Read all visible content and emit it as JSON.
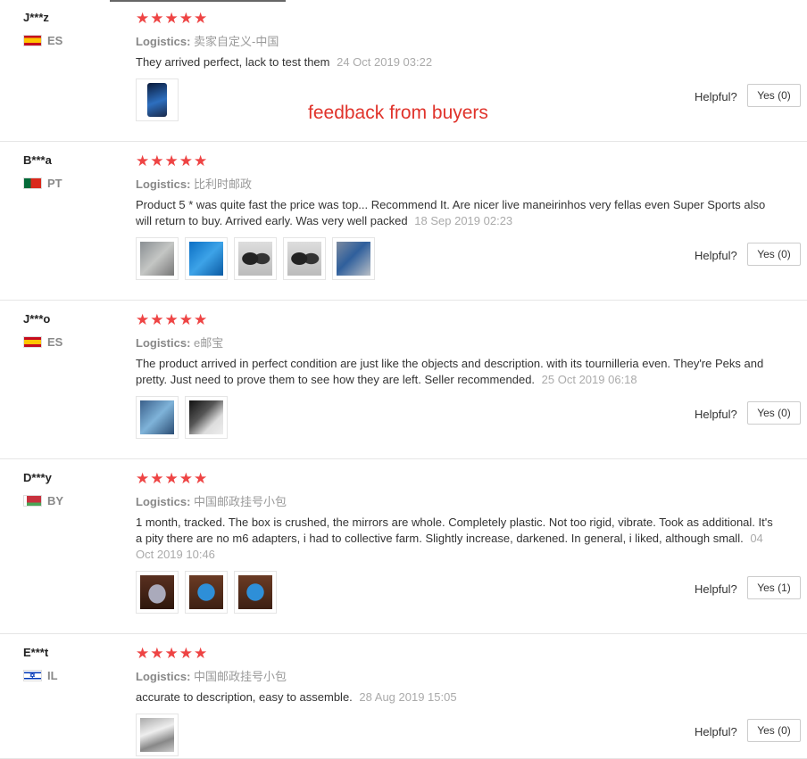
{
  "overlay_text": "feedback from buyers",
  "reviews": [
    {
      "user": "J***z",
      "country": "ES",
      "flag": "flag-es",
      "stars": [
        "★",
        "★",
        "★",
        "★",
        "★"
      ],
      "logistics_label": "Logistics:",
      "logistics": "卖家自定义-中国",
      "text": "They arrived perfect, lack to test them",
      "date": "24 Oct 2019 03:22",
      "photos": [
        "img-phone"
      ],
      "helpful_label": "Helpful?",
      "yes_label": "Yes (0)"
    },
    {
      "user": "B***a",
      "country": "PT",
      "flag": "flag-pt",
      "stars": [
        "★",
        "★",
        "★",
        "★",
        "★"
      ],
      "logistics_label": "Logistics:",
      "logistics": "比利时邮政",
      "text": "Product 5 * was quite fast the price was top... Recommend It. Are nicer live maneirinhos very fellas even Super Sports also will return to buy. Arrived early. Was very well packed",
      "date": "18 Sep 2019 02:23",
      "photos": [
        "img-box-grey",
        "img-box-blue",
        "img-mirror",
        "img-mirror",
        "img-mixed"
      ],
      "helpful_label": "Helpful?",
      "yes_label": "Yes (0)"
    },
    {
      "user": "J***o",
      "country": "ES",
      "flag": "flag-es",
      "stars": [
        "★",
        "★",
        "★",
        "★",
        "★"
      ],
      "logistics_label": "Logistics:",
      "logistics": "e邮宝",
      "text": "The product arrived in perfect condition are just like the objects and description. with its tournilleria even. They're Peks and pretty. Just need to prove them to see how they are left. Seller recommended.",
      "date": "25 Oct 2019 06:18",
      "photos": [
        "img-parcel",
        "img-dark"
      ],
      "helpful_label": "Helpful?",
      "yes_label": "Yes (0)"
    },
    {
      "user": "D***y",
      "country": "BY",
      "flag": "flag-by",
      "stars": [
        "★",
        "★",
        "★",
        "★",
        "★"
      ],
      "logistics_label": "Logistics:",
      "logistics": "中国邮政挂号小包",
      "text": "1 month, tracked. The box is crushed, the mirrors are whole. Completely plastic. Not too rigid, vibrate. Took as additional. It's a pity there are no m6 adapters, i had to collective farm. Slightly increase, darkened. In general, i liked, although small.",
      "date": "04 Oct 2019 10:46",
      "photos": [
        "img-wood-grey",
        "img-wood-blue",
        "img-wood-blue"
      ],
      "helpful_label": "Helpful?",
      "yes_label": "Yes (1)"
    },
    {
      "user": "E***t",
      "country": "IL",
      "flag": "flag-il",
      "stars": [
        "★",
        "★",
        "★",
        "★",
        "★"
      ],
      "logistics_label": "Logistics:",
      "logistics": "中国邮政挂号小包",
      "text": "accurate to description, easy to assemble.",
      "date": "28 Aug 2019 15:05",
      "photos": [
        "img-silver"
      ],
      "helpful_label": "Helpful?",
      "yes_label": "Yes (0)"
    }
  ]
}
